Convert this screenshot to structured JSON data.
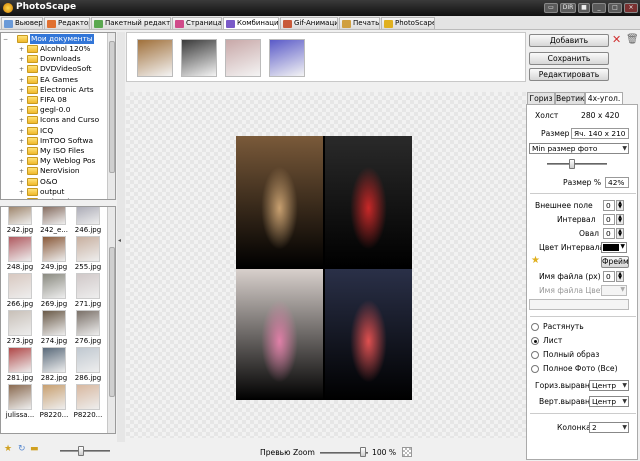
{
  "app": {
    "title": "PhotoScape"
  },
  "tabs": [
    {
      "label": "Вьювер",
      "color": "#6a9ad8"
    },
    {
      "label": "Редактор",
      "color": "#e07030"
    },
    {
      "label": "Пакетный редактор",
      "color": "#5aa850"
    },
    {
      "label": "Страница",
      "color": "#d04a8a"
    },
    {
      "label": "Комбинация",
      "color": "#7a5ac8"
    },
    {
      "label": "Gif-Анимация",
      "color": "#c85a3a"
    },
    {
      "label": "Печать",
      "color": "#d0a040"
    },
    {
      "label": "PhotoScape",
      "color": "#e0b020"
    }
  ],
  "folders": {
    "root": "Мои документы",
    "items": [
      "Alcohol 120%",
      "Downloads",
      "DVDVideoSoft",
      "EA Games",
      "Electronic Arts",
      "FIFA 08",
      "gegl-0.0",
      "Icons and Curso",
      "ICQ",
      "ImTOO Softwa",
      "My ISO Files",
      "My Weblog Pos",
      "NeroVision",
      "O&O",
      "output",
      "Paris Private Ca"
    ]
  },
  "files": [
    {
      "name": "242.jpg",
      "color": "#8a6a4a"
    },
    {
      "name": "242_e...",
      "color": "#6a4a3a"
    },
    {
      "name": "246.jpg",
      "color": "#9a9aa8"
    },
    {
      "name": "248.jpg",
      "color": "#b05a60"
    },
    {
      "name": "249.jpg",
      "color": "#8a5a3a"
    },
    {
      "name": "255.jpg",
      "color": "#c8b0a0"
    },
    {
      "name": "266.jpg",
      "color": "#d8c8c0"
    },
    {
      "name": "269.jpg",
      "color": "#8a8a80"
    },
    {
      "name": "271.jpg",
      "color": "#d0c8c8"
    },
    {
      "name": "273.jpg",
      "color": "#c8c0b8"
    },
    {
      "name": "274.jpg",
      "color": "#6a5a48"
    },
    {
      "name": "276.jpg",
      "color": "#7a7068"
    },
    {
      "name": "281.jpg",
      "color": "#b04848"
    },
    {
      "name": "282.jpg",
      "color": "#5a6a7a"
    },
    {
      "name": "286.jpg",
      "color": "#c0c8d0"
    },
    {
      "name": "julissa...",
      "color": "#8a6a50"
    },
    {
      "name": "P8220...",
      "color": "#c8a070"
    },
    {
      "name": "P8220...",
      "color": "#d8b8a0"
    }
  ],
  "strip_thumbs": [
    {
      "name": "girl-with-teddy",
      "color": "#a0703a"
    },
    {
      "name": "girl-with-guitar",
      "color": "#3a3a3a"
    },
    {
      "name": "girl-in-pink",
      "color": "#c8a8a8"
    },
    {
      "name": "group-photo",
      "color": "#5a5ac8"
    }
  ],
  "collage_cells": [
    {
      "name": "collage-photo-teddy",
      "bg": "#7a5a3a",
      "fg": "#c8a070"
    },
    {
      "name": "collage-photo-guitar",
      "bg": "#2a2a2a",
      "fg": "#c82828"
    },
    {
      "name": "collage-photo-pink",
      "bg": "#d8d0cc",
      "fg": "#e080a8"
    },
    {
      "name": "collage-photo-group",
      "bg": "#2a3048",
      "fg": "#e05050"
    }
  ],
  "preview": {
    "label": "Превью Zoom",
    "zoom": "100 %",
    "zoom_level": 0.9
  },
  "buttons": {
    "add": "Добавить",
    "save": "Сохранить",
    "edit": "Редактировать"
  },
  "right_tabs": [
    "Гориз",
    "Вертик",
    "4х-угол."
  ],
  "settings": {
    "canvas_label": "Холст",
    "canvas_value": "280 x 420",
    "size_label": "Размер",
    "size_value": "Яч. 140 x 210",
    "photo_size_select": "Min размер фото",
    "size_percent_label": "Размер %",
    "size_percent_value": "42%",
    "size_percent_level": 0.42,
    "outer_margin_label": "Внешнее поле",
    "outer_margin_value": "0",
    "interval_label": "Интервал",
    "interval_value": "0",
    "oval_label": "Овал",
    "oval_value": "0",
    "interval_color_label": "Цвет Интервала",
    "interval_color": "#000000",
    "frame_button": "Фрейм",
    "filename_label": "Имя файла (px)",
    "filename_value": "0",
    "filename_color_label": "Имя файла Цвет",
    "modes": [
      "Растянуть",
      "Лист",
      "Полный образ",
      "Полное Фото (Все)"
    ],
    "mode_selected": 1,
    "halign_label": "Гориз.выравн.",
    "halign_value": "Центр",
    "valign_label": "Верт.выравн.",
    "valign_value": "Центр",
    "columns_label": "Колонка",
    "columns_value": "2"
  },
  "window_buttons": [
    "▭",
    "DIR",
    "■",
    "_",
    "□",
    "×"
  ]
}
